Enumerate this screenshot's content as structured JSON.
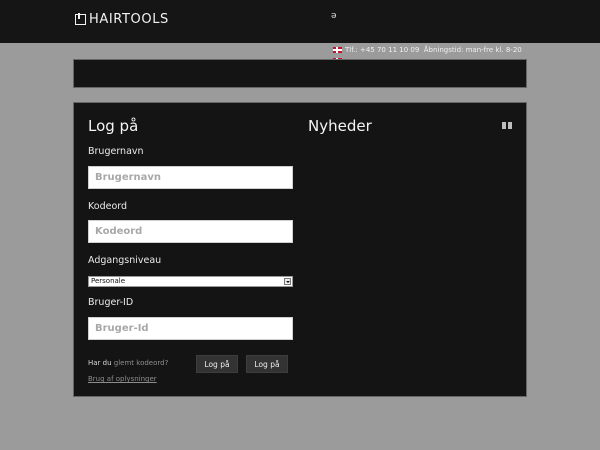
{
  "header": {
    "logo_text": "HAIRTOOLS",
    "top_glyph": "ǝ",
    "contact": {
      "phone": "Tlf.: +45 70 11 10 09",
      "opening_hours": "Åbningstid: man-fre kl. 8-20",
      "flag": "denmark-flag"
    }
  },
  "login": {
    "title": "Log på",
    "username_label": "Brugernavn",
    "username_placeholder": "Brugernavn",
    "username_value": "",
    "password_label": "Kodeord",
    "password_placeholder": "Kodeord",
    "password_value": "",
    "access_level_label": "Adgangsniveau",
    "access_level_selected": "Personale",
    "user_id_label": "Bruger-ID",
    "user_id_placeholder": "Bruger-Id",
    "user_id_value": "",
    "forgot_prefix": "Har du",
    "forgot_link": "glemt kodeord?",
    "terms_link": "Brug af oplysninger",
    "buttons": [
      "Log på",
      "Log på"
    ]
  },
  "news": {
    "title": "Nyheder",
    "pause_icon": "pause-icon"
  },
  "colors": {
    "page_background": "#9b9b9b",
    "panel_background": "#141414",
    "topbar_background": "#151515",
    "button_background": "#333333"
  }
}
